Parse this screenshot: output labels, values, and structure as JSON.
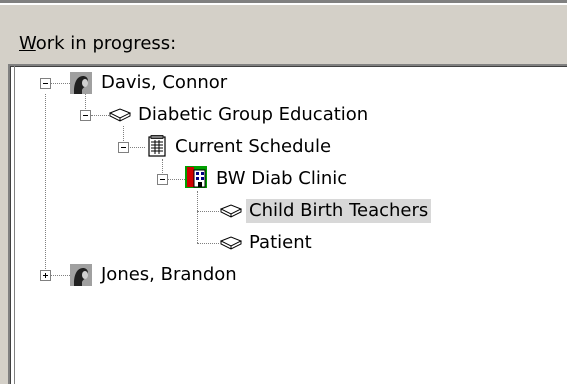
{
  "section": {
    "label_first_letter": "W",
    "label_rest": "ork in progress:"
  },
  "tree": {
    "nodes": [
      {
        "label": "Davis, Connor",
        "icon": "person-icon",
        "expander": "minus"
      },
      {
        "label": "Diabetic Group Education",
        "icon": "open-book-icon",
        "expander": "minus"
      },
      {
        "label": "Current Schedule",
        "icon": "schedule-document-icon",
        "expander": "minus"
      },
      {
        "label": "BW Diab Clinic",
        "icon": "building-icon",
        "expander": "minus"
      },
      {
        "label": "Child Birth Teachers",
        "icon": "open-book-icon",
        "selected": true
      },
      {
        "label": "Patient",
        "icon": "open-book-icon"
      },
      {
        "label": "Jones, Brandon",
        "icon": "person-icon",
        "expander": "plus"
      }
    ]
  }
}
